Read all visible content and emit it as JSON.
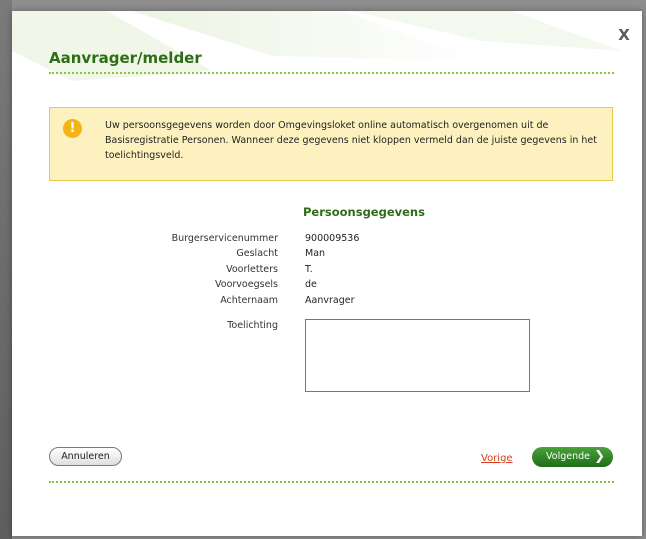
{
  "dialog": {
    "title": "Aanvrager/melder",
    "close_label": "X"
  },
  "warning": {
    "icon": "exclamation-icon",
    "icon_glyph": "!",
    "text": "Uw persoonsgegevens worden door Omgevingsloket online automatisch overgenomen uit de Basisregistratie Personen. Wanneer deze gegevens niet kloppen vermeld dan de juiste gegevens in het toelichtingsveld."
  },
  "section": {
    "title": "Persoonsgegevens"
  },
  "fields": [
    {
      "label": "Burgerservicenummer",
      "value": "900009536"
    },
    {
      "label": "Geslacht",
      "value": "Man"
    },
    {
      "label": "Voorletters",
      "value": "T."
    },
    {
      "label": "Voorvoegsels",
      "value": "de"
    },
    {
      "label": "Achternaam",
      "value": "Aanvrager"
    }
  ],
  "toelichting": {
    "label": "Toelichting",
    "value": ""
  },
  "footer": {
    "cancel_label": "Annuleren",
    "prev_label": "Vorige",
    "next_label": "Volgende",
    "next_icon": "chevron-right-icon",
    "next_glyph": "❯"
  },
  "colors": {
    "accent_green": "#2e6c15",
    "button_green": "#2f8a24",
    "warning_bg": "#fdf2bf",
    "warning_border": "#e6c74f",
    "link_orange": "#d2431c"
  }
}
